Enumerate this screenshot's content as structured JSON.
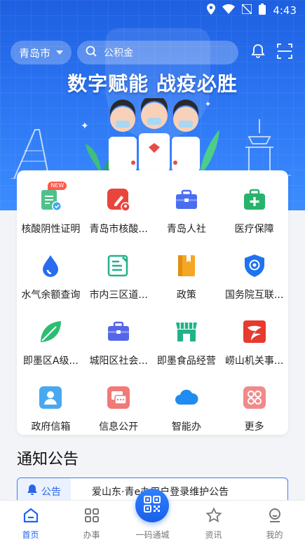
{
  "status_bar": {
    "time": "4:43"
  },
  "header": {
    "city": "青岛市",
    "search_placeholder": "公积金",
    "icons": [
      "bell-icon",
      "scan-icon"
    ]
  },
  "banner": {
    "slogan": "数字赋能 战疫必胜"
  },
  "grid": {
    "items": [
      {
        "label": "核酸阴性证明",
        "icon": "document-check-icon",
        "color": "#4cc28a",
        "badge": "NEW"
      },
      {
        "label": "青岛市核酸...",
        "icon": "test-tube-location-icon",
        "color": "#e8453c"
      },
      {
        "label": "青岛人社",
        "icon": "briefcase-icon",
        "color": "#4a6ef0"
      },
      {
        "label": "医疗保障",
        "icon": "medical-kit-icon",
        "color": "#27b36b"
      },
      {
        "label": "水气余额查询",
        "icon": "water-drop-icon",
        "color": "#2a6cf0"
      },
      {
        "label": "市内三区道...",
        "icon": "form-edit-icon",
        "color": "#22b28a"
      },
      {
        "label": "政策",
        "icon": "book-icon",
        "color": "#f5a623"
      },
      {
        "label": "国务院互联...",
        "icon": "shield-eye-icon",
        "color": "#1e73f0"
      },
      {
        "label": "即墨区A级...",
        "icon": "leaf-icon",
        "color": "#2dbd72"
      },
      {
        "label": "城阳区社会...",
        "icon": "briefcase-icon",
        "color": "#5566e8"
      },
      {
        "label": "即墨食品经营",
        "icon": "store-icon",
        "color": "#22b28a"
      },
      {
        "label": "崂山机关事...",
        "icon": "brand-logo-icon",
        "color": "#e63b2e"
      },
      {
        "label": "政府信箱",
        "icon": "person-card-icon",
        "color": "#4aa8f0"
      },
      {
        "label": "信息公开",
        "icon": "chat-icon",
        "color": "#f07a78"
      },
      {
        "label": "智能办",
        "icon": "cloud-icon",
        "color": "#1e8cf0"
      },
      {
        "label": "更多",
        "icon": "more-grid-icon",
        "color": "#f08a8a"
      }
    ]
  },
  "notice": {
    "title": "通知公告",
    "tag": "公告",
    "text": "爱山东·青e办用户登录维护公告"
  },
  "tabbar": {
    "items": [
      {
        "label": "首页",
        "icon": "home-icon",
        "active": true
      },
      {
        "label": "办事",
        "icon": "apps-icon",
        "active": false
      },
      {
        "label": "一码通城",
        "icon": "qrcode-icon",
        "active": false
      },
      {
        "label": "资讯",
        "icon": "star-icon",
        "active": false
      },
      {
        "label": "我的",
        "icon": "user-icon",
        "active": false
      }
    ]
  },
  "colors": {
    "brand_blue": "#1e64f0",
    "hero_top": "#1d5fe0"
  }
}
